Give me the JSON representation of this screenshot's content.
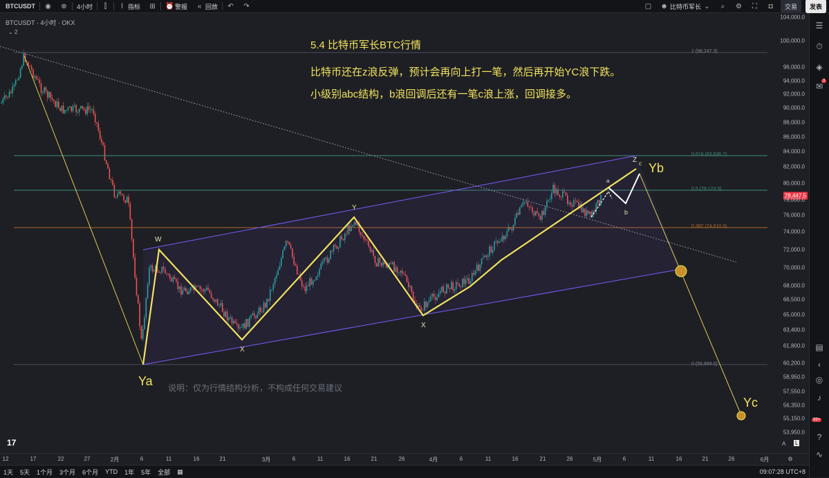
{
  "toolbar": {
    "symbol": "BTCUSDT",
    "interval": "4小时",
    "indicators": "指标",
    "alert": "警报",
    "replay": "回放",
    "layout_name": "比特币军长",
    "trade": "交易",
    "publish": "发表"
  },
  "legend": {
    "title": "BTCUSDT · 4小时 · OKX",
    "count": "2"
  },
  "annotations": {
    "headline": "5.4 比特币军长BTC行情",
    "line1": "比特币还在z浪反弹，预计会再向上打一笔，然后再开始YC浪下跌。",
    "line2": "小级别abc结构，b浪回调后还有一笔c浪上涨，回调接多。",
    "disclaimer": "说明：仅为行情结构分析，不构成任何交易建议"
  },
  "fib_levels": [
    {
      "label": "1 (98,247.3)",
      "price": 98247.3
    },
    {
      "label": "0.618 (83,636.7)",
      "price": 83636.7
    },
    {
      "label": "0.5 (79,123.5)",
      "price": 79123.5
    },
    {
      "label": "0.382 (74,610.3)",
      "price": 74610.3
    },
    {
      "label": "0 (59,999.0)",
      "price": 59999.0
    }
  ],
  "wave_labels": {
    "ya": "Ya",
    "w": "W",
    "x1": "X",
    "y": "Y",
    "x2": "X",
    "z": "Z",
    "c": "c",
    "a": "a",
    "b": "b",
    "yb": "Yb",
    "yc": "Yc"
  },
  "price_axis": {
    "labels": [
      "104,000.0",
      "100,000.0",
      "96,000.0",
      "94,000.0",
      "92,000.0",
      "90,000.0",
      "88,000.0",
      "86,000.0",
      "84,000.0",
      "82,000.0",
      "80,000.0",
      "78,000.0",
      "76,000.0",
      "74,000.0",
      "72,000.0",
      "70,000.0",
      "68,000.0",
      "66,500.0",
      "65,000.0",
      "63,400.0",
      "61,800.0",
      "60,200.0",
      "58,950.0",
      "57,550.0",
      "56,350.0",
      "55,150.0",
      "53,950.0"
    ],
    "current_price": "78,447.5",
    "btn_a": "A",
    "btn_l": "L"
  },
  "time_axis": {
    "labels": [
      "12",
      "17",
      "22",
      "27",
      "2月",
      "6",
      "11",
      "16",
      "21",
      "3月",
      "6",
      "11",
      "16",
      "21",
      "26",
      "4月",
      "6",
      "11",
      "16",
      "21",
      "26",
      "5月",
      "6",
      "11",
      "16",
      "21",
      "26",
      "6月"
    ],
    "clock": "09:07:28 UTC+8"
  },
  "ranges": [
    "1天",
    "5天",
    "1个月",
    "3个月",
    "6个月",
    "YTD",
    "1年",
    "5年",
    "全部"
  ],
  "sidebar_badges": {
    "alerts": "3",
    "notifications": "99+"
  },
  "colors": {
    "up": "#26a69a",
    "down": "#ef5350",
    "wave": "#f2e35e",
    "channel": "#7b5cff",
    "accent": "#f23645"
  }
}
